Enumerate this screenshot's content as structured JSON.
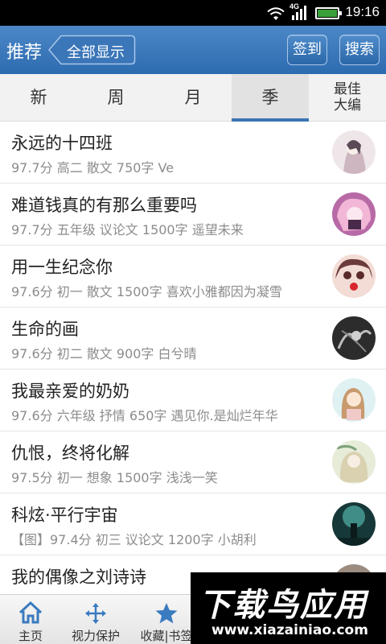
{
  "status_bar": {
    "time": "19:16",
    "network": "4G"
  },
  "header": {
    "title": "推荐",
    "back_label": "全部显示",
    "signin_label": "签到",
    "search_label": "搜索"
  },
  "tabs": [
    {
      "label": "新"
    },
    {
      "label": "周"
    },
    {
      "label": "月"
    },
    {
      "label": "季",
      "active": true
    },
    {
      "label": "最佳大编",
      "line1": "最佳",
      "line2": "大编"
    }
  ],
  "articles": [
    {
      "title": "永远的十四班",
      "meta": "97.7分 高二 散文 750字 Ve",
      "avatar_color": "#d9c8cf"
    },
    {
      "title": "难道钱真的有那么重要吗",
      "meta": "97.7分 五年级 议论文 1500字 遥望未来",
      "avatar_color": "#c77fb0"
    },
    {
      "title": "用一生纪念你",
      "meta": "97.6分 初一 散文 1500字 喜欢小雅都因为凝雪",
      "avatar_color": "#e6b7b2"
    },
    {
      "title": "生命的画",
      "meta": "97.6分 初二 散文 900字 白兮晴",
      "avatar_color": "#3a3a3a"
    },
    {
      "title": "我最亲爱的奶奶",
      "meta": "97.6分 六年级 抒情 650字 遇见你.是灿烂年华",
      "avatar_color": "#e9d4b8"
    },
    {
      "title": "仇恨，终将化解",
      "meta": "97.5分 初一 想象 1500字 浅浅一笑",
      "avatar_color": "#b9c9a8"
    },
    {
      "title": "科炫·平行宇宙",
      "meta": "【图】97.4分 初三 议论文 1200字 小胡利",
      "avatar_color": "#1f4a4a"
    },
    {
      "title": "我的偶像之刘诗诗",
      "meta": "",
      "avatar_color": "#9c8c80"
    }
  ],
  "bottom_nav": [
    {
      "label": "主页",
      "icon": "home-icon"
    },
    {
      "label": "视力保护",
      "icon": "move-arrows-icon"
    },
    {
      "label": "收藏|书签",
      "icon": "star-icon"
    }
  ],
  "watermark": {
    "title": "下载鸟应用",
    "url": "www.xiazainiao.com"
  }
}
